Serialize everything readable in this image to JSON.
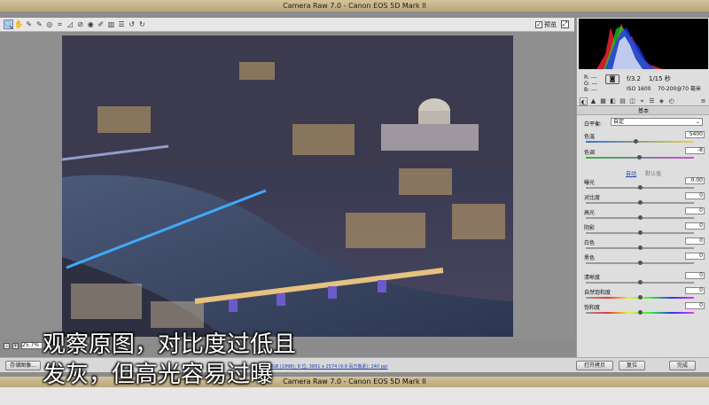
{
  "app": {
    "title": "Camera Raw 7.0 -  Canon EOS 5D Mark II"
  },
  "toolbar": {
    "tools": [
      {
        "name": "zoom-tool-icon",
        "glyph": "🔍"
      },
      {
        "name": "hand-tool-icon",
        "glyph": "✋"
      },
      {
        "name": "white-balance-tool-icon",
        "glyph": "✎"
      },
      {
        "name": "color-sampler-tool-icon",
        "glyph": "✎"
      },
      {
        "name": "targeted-adjustment-tool-icon",
        "glyph": "◎"
      },
      {
        "name": "crop-tool-icon",
        "glyph": "⌗"
      },
      {
        "name": "straighten-tool-icon",
        "glyph": "◿"
      },
      {
        "name": "spot-removal-tool-icon",
        "glyph": "⊘"
      },
      {
        "name": "red-eye-tool-icon",
        "glyph": "◉"
      },
      {
        "name": "adjustment-brush-icon",
        "glyph": "✐"
      },
      {
        "name": "graduated-filter-icon",
        "glyph": "▥"
      },
      {
        "name": "preferences-icon",
        "glyph": "☰"
      },
      {
        "name": "rotate-left-icon",
        "glyph": "↺"
      },
      {
        "name": "rotate-right-icon",
        "glyph": "↻"
      }
    ],
    "preview_label": "预览",
    "preview_checked": "✓"
  },
  "zoom": {
    "minus": "-",
    "plus": "+",
    "value": "25.7%"
  },
  "bottom": {
    "save_button": "存储图像...",
    "workflow_link": "Adobe RGB (1998); 8 位; 3861 x 2574 (9.9 百万像素); 240 ppi",
    "open_button": "打开拷贝",
    "reset_button": "复位",
    "done_button": "完成"
  },
  "caption": {
    "line1": "观察原图，对比度过低且",
    "line2": "发灰，但高光容易过曝"
  },
  "panel": {
    "rgb": {
      "r": "R:  ---",
      "g": "G:  ---",
      "b": "B:  ---"
    },
    "aperture": "f/3.2",
    "shutter": "1/15 秒",
    "iso": "ISO 1600",
    "lens": "70-200@70 毫米",
    "section_title": "基本",
    "white_balance_label": "白平衡:",
    "white_balance_value": "自定",
    "auto_label": "自动",
    "default_label": "默认值",
    "sliders": [
      {
        "key": "temperature",
        "label": "色温",
        "value": "5400",
        "pos": 0.46
      },
      {
        "key": "tint",
        "label": "色调",
        "value": "-8",
        "pos": 0.49
      },
      {
        "key": "exposure",
        "label": "曝光",
        "value": "0.00",
        "pos": 0.5
      },
      {
        "key": "contrast",
        "label": "对比度",
        "value": "0",
        "pos": 0.5
      },
      {
        "key": "highlights",
        "label": "高光",
        "value": "0",
        "pos": 0.5
      },
      {
        "key": "shadows",
        "label": "阴影",
        "value": "0",
        "pos": 0.5
      },
      {
        "key": "whites",
        "label": "白色",
        "value": "0",
        "pos": 0.5
      },
      {
        "key": "blacks",
        "label": "黑色",
        "value": "0",
        "pos": 0.5
      },
      {
        "key": "clarity",
        "label": "清晰度",
        "value": "0",
        "pos": 0.5
      },
      {
        "key": "vibrance",
        "label": "自然饱和度",
        "value": "0",
        "pos": 0.5
      },
      {
        "key": "saturation",
        "label": "饱和度",
        "value": "0",
        "pos": 0.5
      }
    ]
  }
}
